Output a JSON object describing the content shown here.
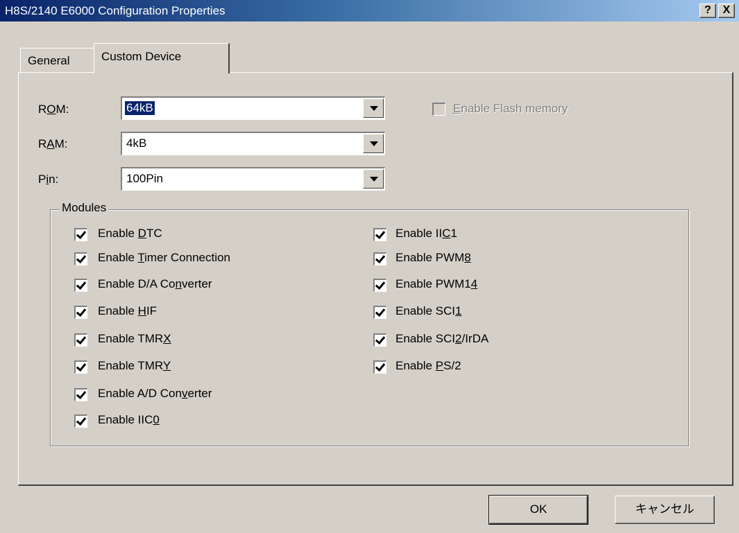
{
  "window": {
    "title": "H8S/2140 E6000 Configuration Properties",
    "help_label": "?",
    "close_label": "X"
  },
  "tabs": [
    {
      "label": "General",
      "active": false
    },
    {
      "label": "Custom Device",
      "active": true
    }
  ],
  "rom": {
    "label_pre": "R",
    "label_key": "O",
    "label_post": "M:",
    "value": "64kB"
  },
  "ram": {
    "label_pre": "R",
    "label_key": "A",
    "label_post": "M:",
    "value": "4kB"
  },
  "pin": {
    "label_pre": "P",
    "label_key": "i",
    "label_post": "n:",
    "value": "100Pin"
  },
  "flash": {
    "label_key": "E",
    "label_post": "nable Flash memory",
    "checked": false,
    "enabled": false
  },
  "modules": {
    "title": "Modules",
    "left": [
      {
        "pre": "Enable ",
        "key": "D",
        "post": "TC",
        "checked": true
      },
      {
        "pre": "Enable ",
        "key": "T",
        "post": "imer Connection",
        "checked": true
      },
      {
        "pre": "Enable D/A Co",
        "key": "n",
        "post": "verter",
        "checked": true
      },
      {
        "pre": "Enable ",
        "key": "H",
        "post": "IF",
        "checked": true
      },
      {
        "pre": "Enable TMR",
        "key": "X",
        "post": "",
        "checked": true
      },
      {
        "pre": "Enable TMR",
        "key": "Y",
        "post": "",
        "checked": true
      },
      {
        "pre": "Enable A/D Con",
        "key": "v",
        "post": "erter",
        "checked": true
      },
      {
        "pre": "Enable IIC",
        "key": "0",
        "post": "",
        "checked": true
      }
    ],
    "right": [
      {
        "pre": "Enable II",
        "key": "C",
        "post": "1",
        "checked": true
      },
      {
        "pre": "Enable PWM",
        "key": "8",
        "post": "",
        "checked": true
      },
      {
        "pre": "Enable PWM1",
        "key": "4",
        "post": "",
        "checked": true
      },
      {
        "pre": "Enable SCI",
        "key": "1",
        "post": "",
        "checked": true
      },
      {
        "pre": "Enable SCI",
        "key": "2",
        "post": "/IrDA",
        "checked": true
      },
      {
        "pre": "Enable ",
        "key": "P",
        "post": "S/2",
        "checked": true
      }
    ]
  },
  "buttons": {
    "ok": "OK",
    "cancel": "キャンセル"
  }
}
